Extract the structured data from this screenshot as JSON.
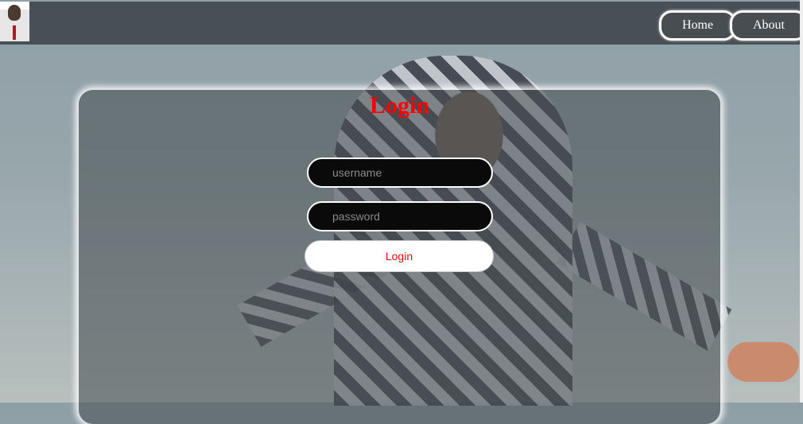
{
  "navbar": {
    "logo_alt": "profile photo",
    "home_label": "Home",
    "about_label": "About"
  },
  "login": {
    "title": "Login",
    "username_placeholder": "username",
    "password_placeholder": "password",
    "submit_label": "Login"
  },
  "colors": {
    "title": "#ff0000",
    "button_text": "#e01010",
    "navbar": "#474d51"
  }
}
